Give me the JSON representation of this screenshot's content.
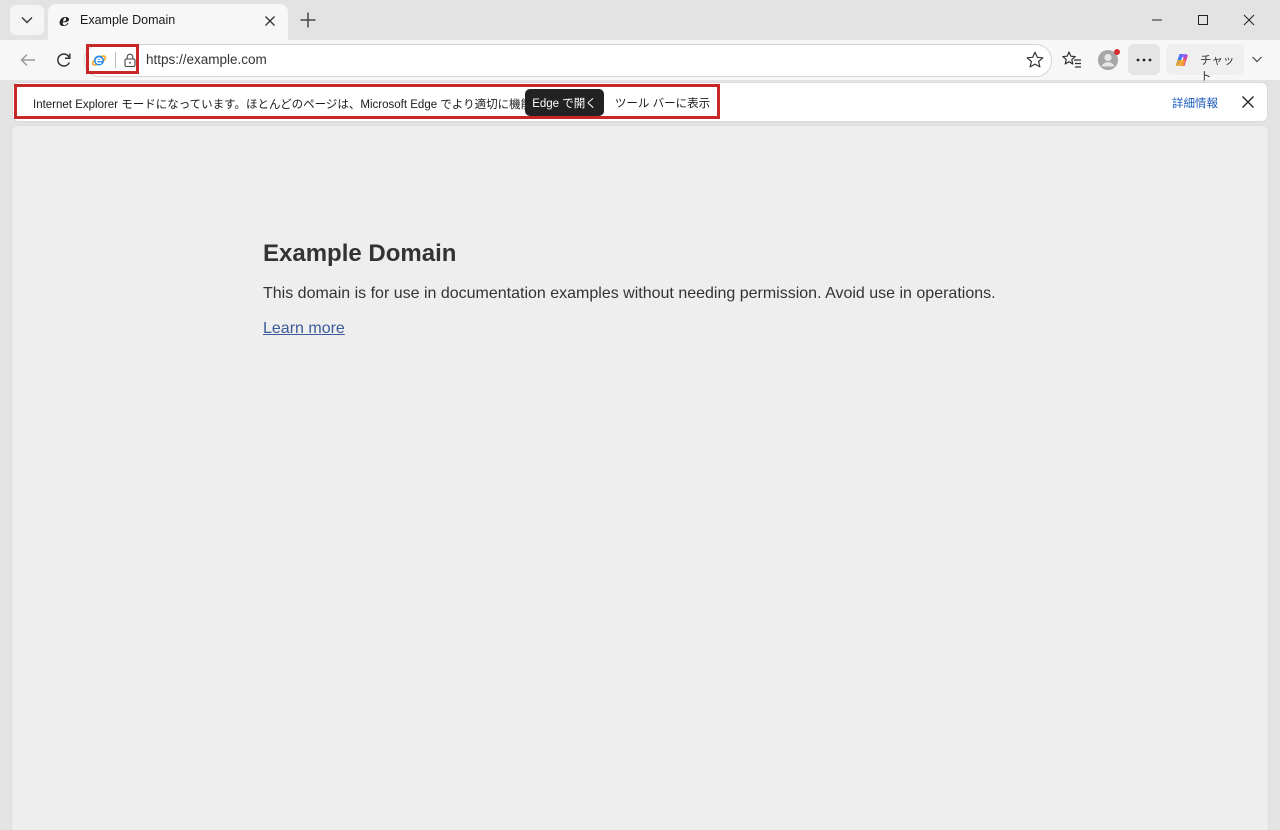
{
  "tab": {
    "title": "Example Domain"
  },
  "toolbar": {
    "url": "https://example.com",
    "copilot_label": "チャット"
  },
  "infobar": {
    "message": "Internet Explorer モードになっています。ほとんどのページは、Microsoft Edge でより適切に機能します。",
    "open_in_edge_label": "Edge で開く",
    "show_in_toolbar_label": "ツール バーに表示",
    "details_label": "詳細情報"
  },
  "page": {
    "heading": "Example Domain",
    "paragraph": "This domain is for use in documentation examples without needing permission. Avoid use in operations.",
    "link_label": "Learn more"
  },
  "colors": {
    "highlight": "#c62828",
    "link": "#3c5a99",
    "details_link": "#1a5bbd",
    "ie_blue": "#1e88e5",
    "ie_gold": "#f9a825"
  },
  "icons": [
    "chevron-down-icon",
    "ie-icon",
    "close-icon",
    "plus-icon",
    "minimize-icon",
    "maximize-icon",
    "back-arrow-icon",
    "reload-icon",
    "lock-icon",
    "star-icon",
    "favorites-icon",
    "profile-icon",
    "more-icon",
    "copilot-icon"
  ]
}
